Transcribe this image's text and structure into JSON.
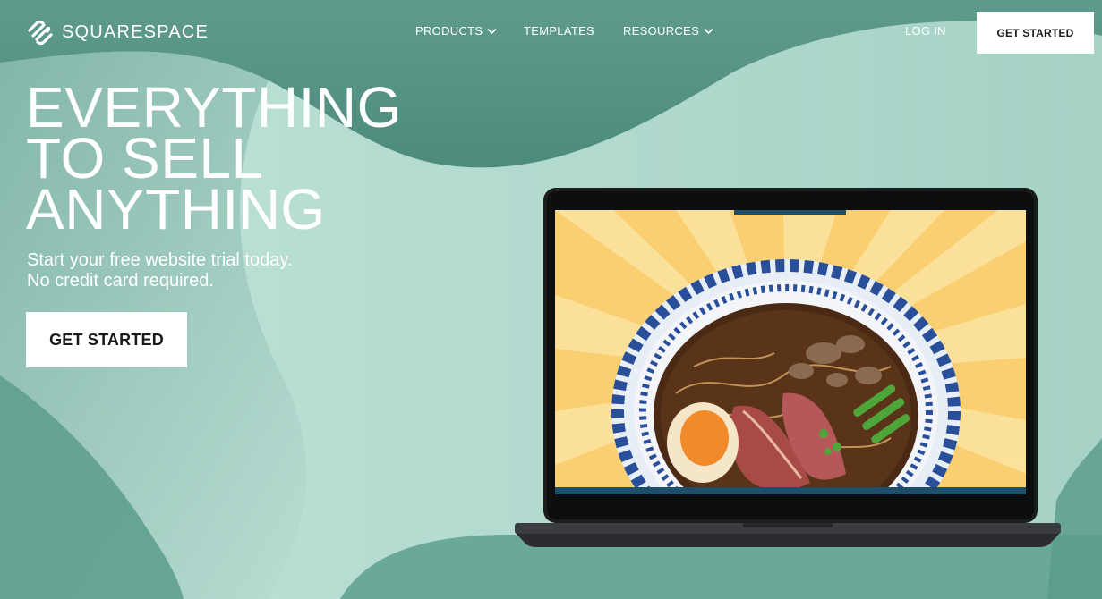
{
  "brand": {
    "name": "SQUARESPACE",
    "logo_icon": "squarespace-logo-icon"
  },
  "nav": {
    "products": "PRODUCTS",
    "templates": "TEMPLATES",
    "resources": "RESOURCES",
    "login": "LOG IN",
    "cta": "GET STARTED"
  },
  "hero": {
    "title_lines": [
      "EVERYTHING",
      "TO SELL",
      "ANYTHING"
    ],
    "subtitle_lines": [
      "Start your free website trial today.",
      "No credit card required."
    ],
    "cta": "GET STARTED"
  },
  "visual": {
    "laptop_screen_subject": "ramen-bowl-image",
    "colors": {
      "background": "#a9d3c8",
      "wave_dark": "#5f9f8f",
      "screen_yellow": "#f9cf72",
      "bowl_blue": "#2a4f9a"
    }
  }
}
